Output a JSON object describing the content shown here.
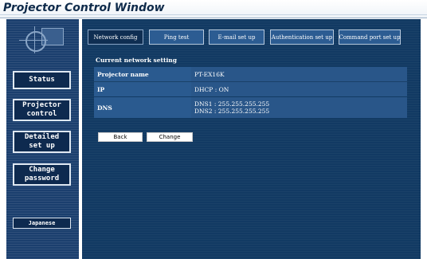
{
  "window": {
    "title": "Projector Control Window"
  },
  "sidebar": {
    "items": [
      {
        "label": "Status"
      },
      {
        "label": "Projector\ncontrol"
      },
      {
        "label": "Detailed\nset up"
      },
      {
        "label": "Change\npassword"
      }
    ],
    "language_label": "Japanese"
  },
  "tabs": [
    {
      "label": "Network config"
    },
    {
      "label": "Ping test"
    },
    {
      "label": "E-mail set up"
    },
    {
      "label": "Authentication set up"
    },
    {
      "label": "Command port set up"
    }
  ],
  "section": {
    "heading": "Current network setting"
  },
  "settings": [
    {
      "key": "Projector name",
      "value": "PT-EX16K"
    },
    {
      "key": "IP",
      "value": "DHCP : ON"
    },
    {
      "key": "DNS",
      "value_lines": [
        "DNS1 : 255.255.255.255",
        "DNS2 : 255.255.255.255"
      ]
    }
  ],
  "actions": {
    "back_label": "Back",
    "change_label": "Change"
  }
}
